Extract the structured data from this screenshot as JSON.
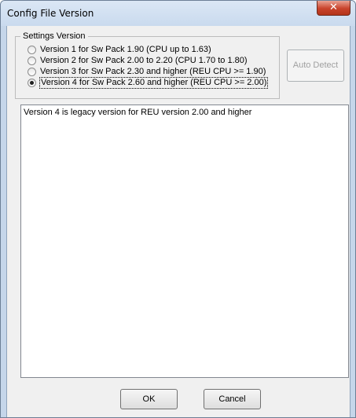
{
  "window": {
    "title": "Config File Version",
    "close_glyph": "✕"
  },
  "settings": {
    "group_label": "Settings Version",
    "options": [
      {
        "label": "Version 1 for Sw Pack 1.90 (CPU up to 1.63)",
        "checked": false
      },
      {
        "label": "Version 2 for Sw Pack 2.00 to 2.20 (CPU 1.70 to 1.80)",
        "checked": false
      },
      {
        "label": "Version 3 for Sw Pack 2.30 and higher (REU CPU >= 1.90)",
        "checked": false
      },
      {
        "label": "Version 4 for Sw Pack 2.60 and higher (REU CPU >= 2.00)",
        "checked": true
      }
    ]
  },
  "buttons": {
    "auto_detect": "Auto Detect",
    "ok": "OK",
    "cancel": "Cancel"
  },
  "description": {
    "text": "Version 4 is legacy version for REU version 2.00 and higher"
  }
}
